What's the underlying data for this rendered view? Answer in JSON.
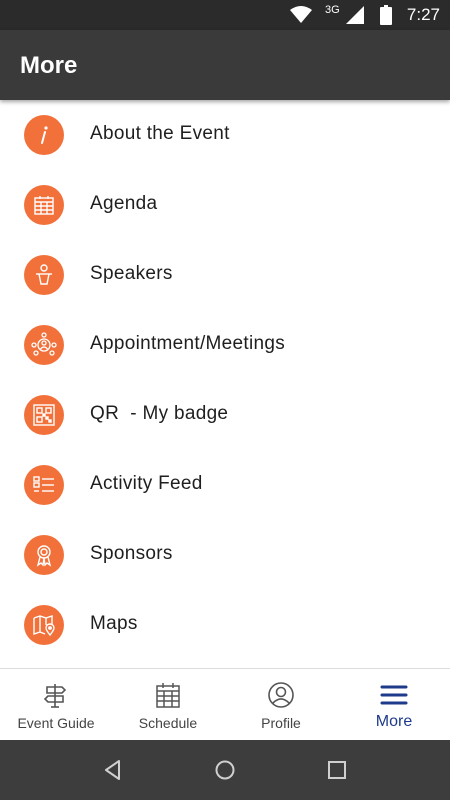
{
  "status_bar": {
    "network": "3G",
    "time": "7:27"
  },
  "app_bar": {
    "title": "More"
  },
  "menu": {
    "accent_color": "#f2713b",
    "items": [
      {
        "label": "About the Event",
        "icon": "info-icon"
      },
      {
        "label": "Agenda",
        "icon": "calendar-icon"
      },
      {
        "label": "Speakers",
        "icon": "speaker-podium-icon"
      },
      {
        "label": "Appointment/Meetings",
        "icon": "network-people-icon"
      },
      {
        "label": "QR  - My badge",
        "icon": "qr-code-icon"
      },
      {
        "label": "Activity Feed",
        "icon": "list-feed-icon"
      },
      {
        "label": "Sponsors",
        "icon": "award-ribbon-icon"
      },
      {
        "label": "Maps",
        "icon": "map-pin-icon"
      }
    ]
  },
  "bottom_nav": {
    "active_color": "#1e3a8a",
    "tabs": [
      {
        "label": "Event Guide",
        "icon": "signpost-icon"
      },
      {
        "label": "Schedule",
        "icon": "calendar-icon"
      },
      {
        "label": "Profile",
        "icon": "user-circle-icon"
      },
      {
        "label": "More",
        "icon": "hamburger-menu-icon",
        "active": true
      }
    ]
  },
  "system_nav": {
    "buttons": [
      "back-icon",
      "home-icon",
      "recents-icon"
    ]
  }
}
